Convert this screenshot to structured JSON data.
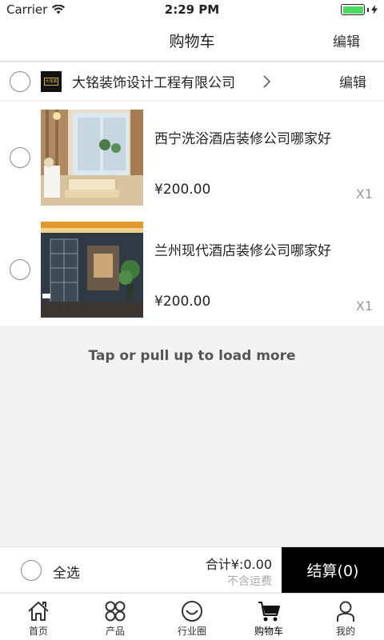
{
  "status_bar": {
    "carrier": "Carrier",
    "time": "2:29 PM"
  },
  "nav": {
    "title": "购物车",
    "edit": "编辑"
  },
  "store": {
    "name": "大铭装饰设计工程有限公司",
    "edit": "编辑",
    "logo_text": "大铭装饰"
  },
  "items": [
    {
      "title": "西宁洗浴酒店装修公司哪家好",
      "price": "¥200.00",
      "qty": "X1"
    },
    {
      "title": "兰州现代酒店装修公司哪家好",
      "price": "¥200.00",
      "qty": "X1"
    }
  ],
  "load_more": "Tap or pull up to load more",
  "checkout": {
    "select_all": "全选",
    "total": "合计¥:0.00",
    "shipping": "不含运费",
    "button": "结算(0)"
  },
  "tabs": [
    {
      "label": "首页",
      "icon": "home-icon"
    },
    {
      "label": "产品",
      "icon": "products-icon"
    },
    {
      "label": "行业圈",
      "icon": "smile-icon"
    },
    {
      "label": "购物车",
      "icon": "cart-icon"
    },
    {
      "label": "我的",
      "icon": "user-icon"
    }
  ],
  "colors": {
    "accent": "#000000",
    "battery": "#4cd964",
    "background": "#f3f3f3"
  }
}
